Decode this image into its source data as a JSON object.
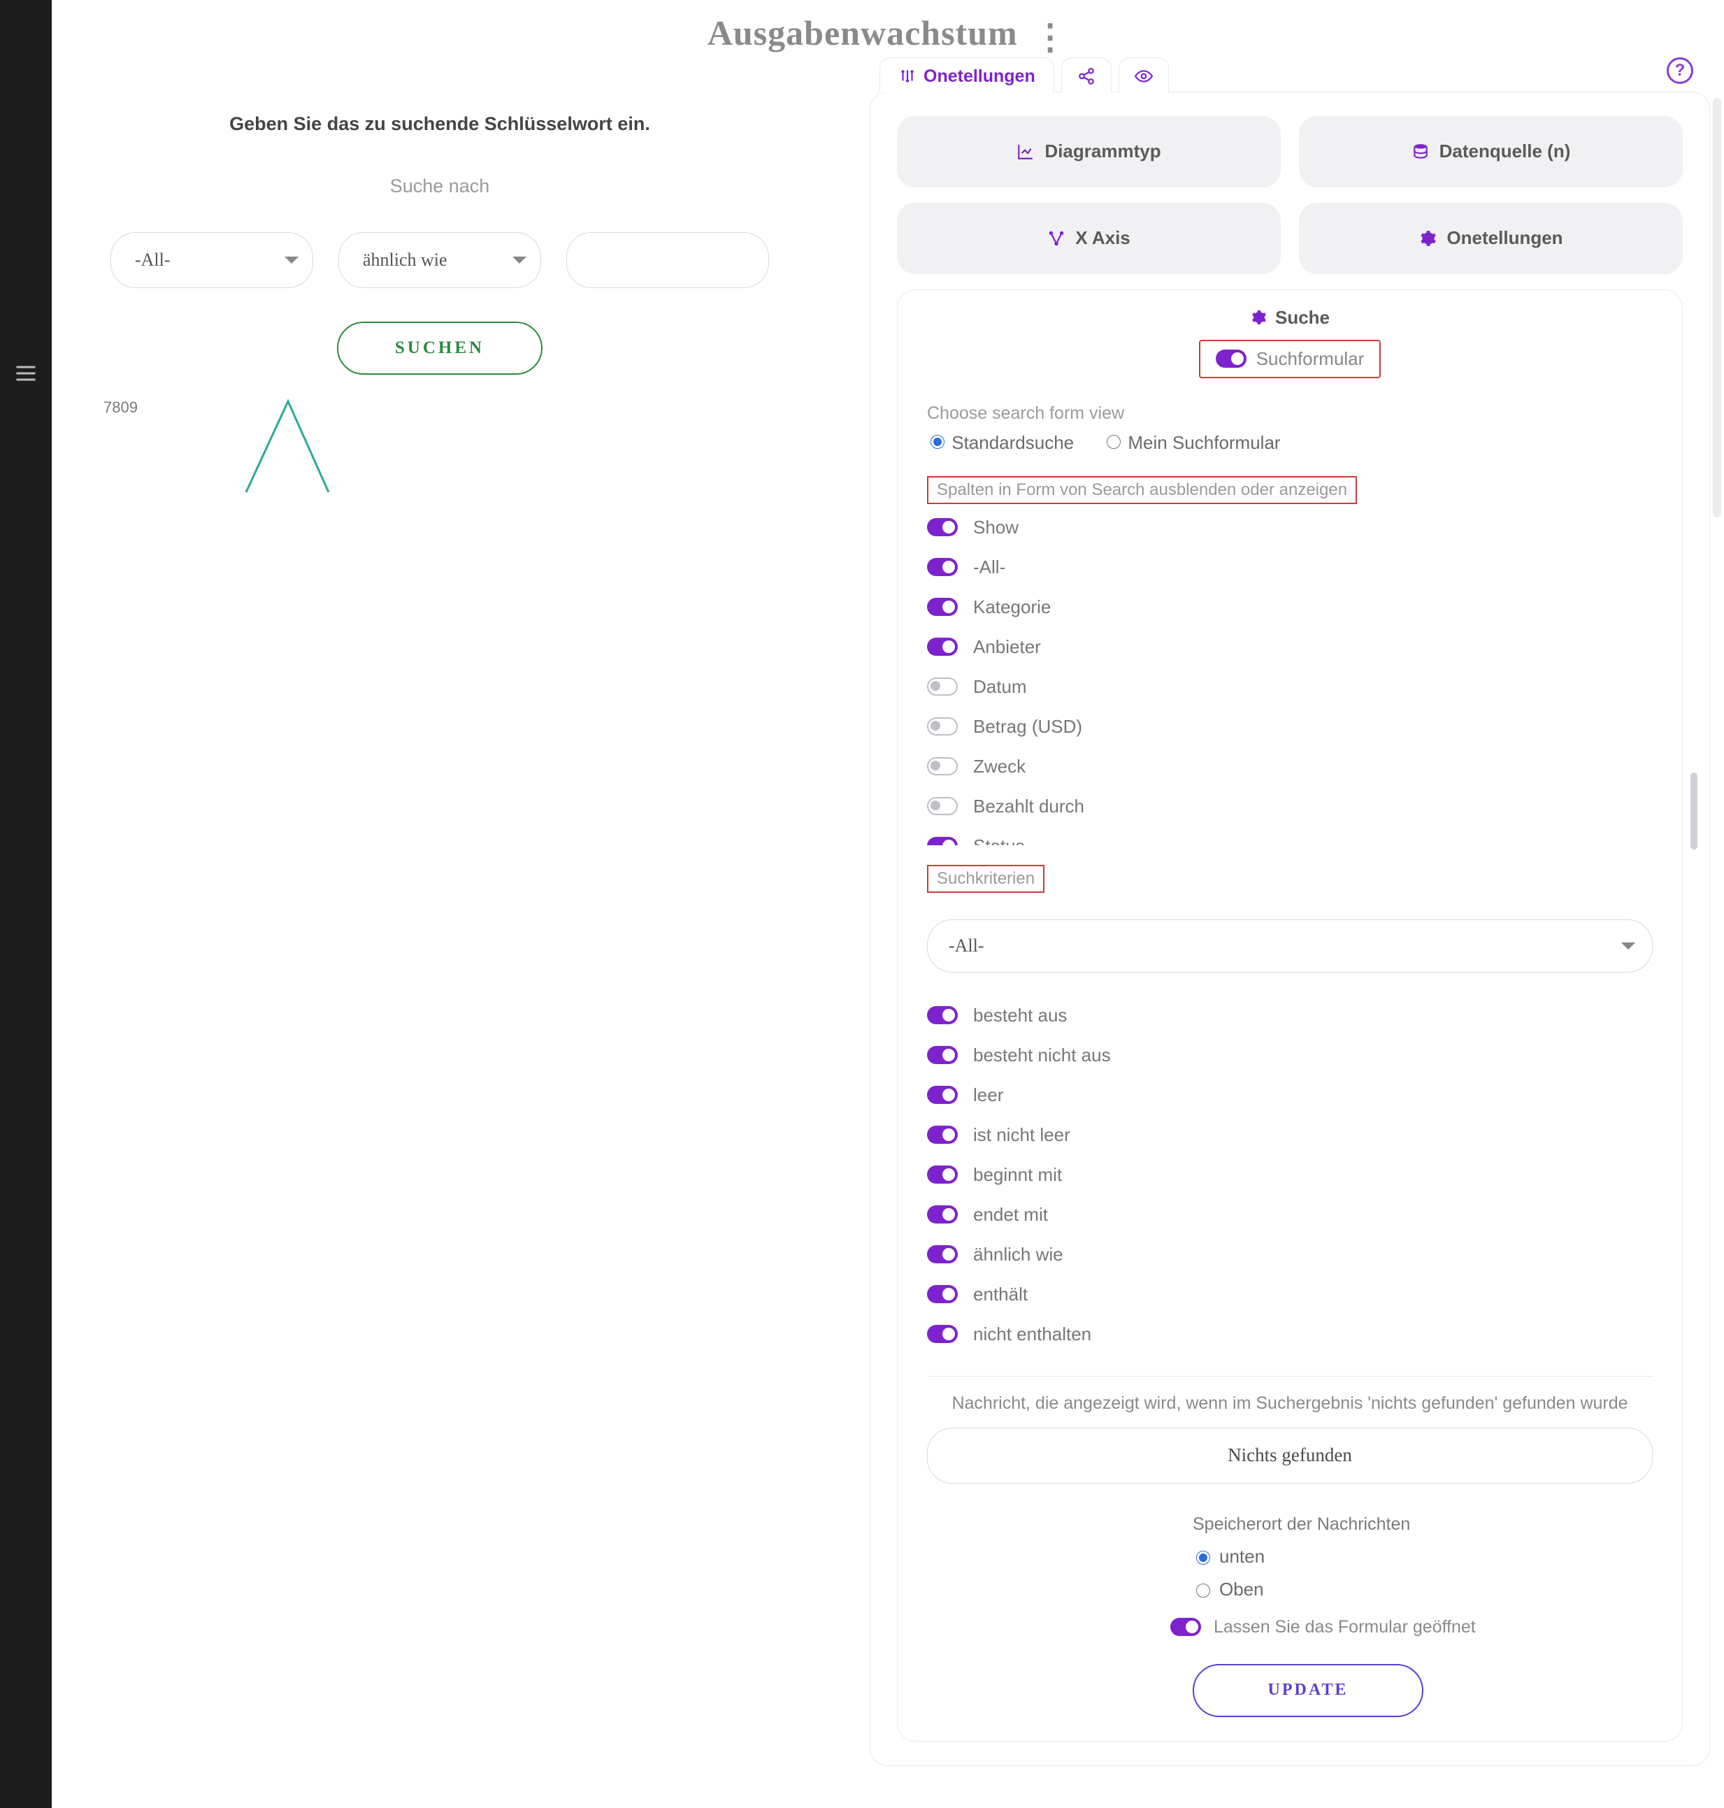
{
  "page": {
    "title": "Ausgabenwachstum"
  },
  "left": {
    "prompt": "Geben Sie das zu suchende Schlüsselwort ein.",
    "sub": "Suche nach",
    "select1": "-All-",
    "select2": "ähnlich wie",
    "input_value": "",
    "search_btn": "SUCHEN",
    "chart_y_tick": "7809"
  },
  "tabs": {
    "settings": "Onetellungen"
  },
  "buttons": {
    "chart_type": "Diagrammtyp",
    "datasource": "Datenquelle (n)",
    "xaxis": "X Axis",
    "settings": "Onetellungen"
  },
  "search_card": {
    "head": "Suche",
    "chip": "Suchformular",
    "choose_label": "Choose search form view",
    "radio_std": "Standardsuche",
    "radio_mine": "Mein Suchformular",
    "cols_label": "Spalten in Form von Search ausblenden oder anzeigen",
    "columns": [
      {
        "label": "Show",
        "on": true
      },
      {
        "label": "-All-",
        "on": true
      },
      {
        "label": "Kategorie",
        "on": true
      },
      {
        "label": "Anbieter",
        "on": true
      },
      {
        "label": "Datum",
        "on": false
      },
      {
        "label": "Betrag (USD)",
        "on": false
      },
      {
        "label": "Zweck",
        "on": false
      },
      {
        "label": "Bezahlt durch",
        "on": false
      },
      {
        "label": "Status",
        "on": true
      }
    ],
    "criteria_label": "Suchkriterien",
    "criteria_value": "-All-",
    "criteria": [
      {
        "label": "besteht aus",
        "on": true
      },
      {
        "label": "besteht nicht aus",
        "on": true
      },
      {
        "label": "leer",
        "on": true
      },
      {
        "label": "ist nicht leer",
        "on": true
      },
      {
        "label": "beginnt mit",
        "on": true
      },
      {
        "label": "endet mit",
        "on": true
      },
      {
        "label": "ähnlich wie",
        "on": true
      },
      {
        "label": "enthält",
        "on": true
      },
      {
        "label": "nicht enthalten",
        "on": true
      }
    ],
    "msg_label": "Nachricht, die angezeigt wird, wenn im Suchergebnis 'nichts gefunden' gefunden wurde",
    "msg_value": "Nichts gefunden",
    "loc_title": "Speicherort der Nachrichten",
    "loc_bottom": "unten",
    "loc_top": "Oben",
    "keep_open": "Lassen Sie das Formular geöffnet",
    "update": "UPDATE"
  },
  "chart_data": {
    "type": "line",
    "x": [
      0,
      1,
      2,
      3
    ],
    "values": [
      0,
      7809,
      0,
      0
    ],
    "ylim": [
      0,
      7809
    ],
    "title": "",
    "xlabel": "",
    "ylabel": ""
  }
}
